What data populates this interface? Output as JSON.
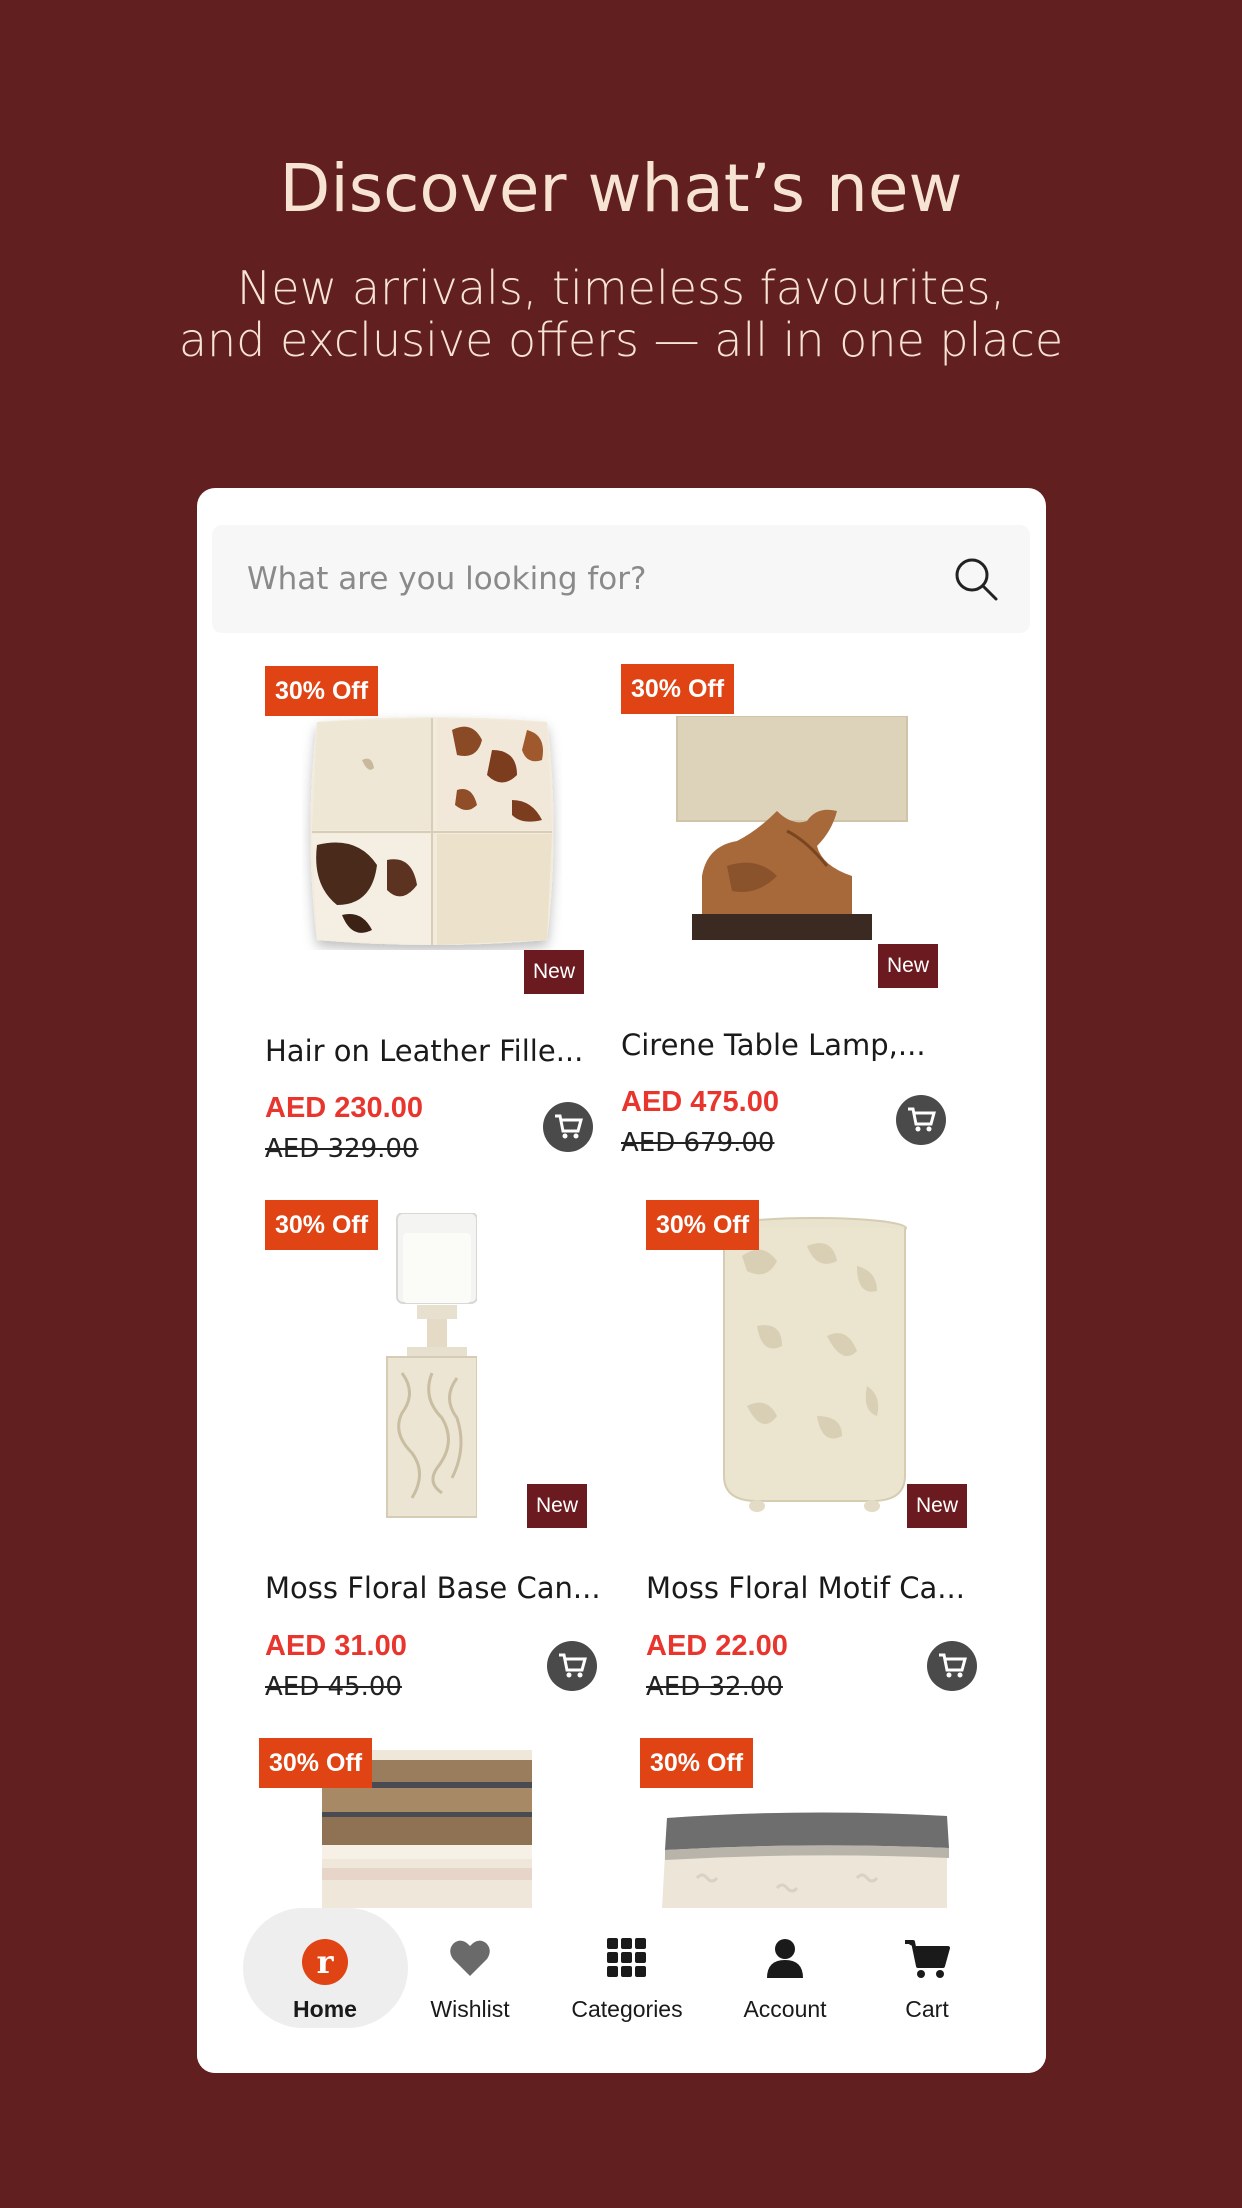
{
  "hero": {
    "title": "Discover what’s new",
    "subtitle_line1": "New arrivals, timeless favourites,",
    "subtitle_line2": "and exclusive offers — all in one place"
  },
  "search": {
    "placeholder": "What are you looking for?",
    "icon": "search-icon"
  },
  "products": [
    {
      "name": "Hair on Leather Fille...",
      "price": "AED 230.00",
      "old_price": "AED 329.00",
      "discount": "30% Off",
      "tag": "New"
    },
    {
      "name": "Cirene Table Lamp,...",
      "price": "AED 475.00",
      "old_price": "AED 679.00",
      "discount": "30% Off",
      "tag": "New"
    },
    {
      "name": "Moss Floral Base Can...",
      "price": "AED 31.00",
      "old_price": "AED 45.00",
      "discount": "30% Off",
      "tag": "New"
    },
    {
      "name": "Moss Floral Motif Ca...",
      "price": "AED 22.00",
      "old_price": "AED 32.00",
      "discount": "30% Off",
      "tag": "New"
    },
    {
      "discount": "30% Off"
    },
    {
      "discount": "30% Off"
    }
  ],
  "nav": {
    "items": [
      {
        "label": "Home",
        "icon": "brand-logo-icon",
        "active": true
      },
      {
        "label": "Wishlist",
        "icon": "heart-icon"
      },
      {
        "label": "Categories",
        "icon": "grid-icon"
      },
      {
        "label": "Account",
        "icon": "user-icon"
      },
      {
        "label": "Cart",
        "icon": "cart-icon"
      }
    ]
  },
  "colors": {
    "background": "#621f20",
    "discount_badge": "#e04414",
    "new_badge": "#6b1b1f",
    "price": "#e8352d",
    "brand": "#e04414"
  }
}
